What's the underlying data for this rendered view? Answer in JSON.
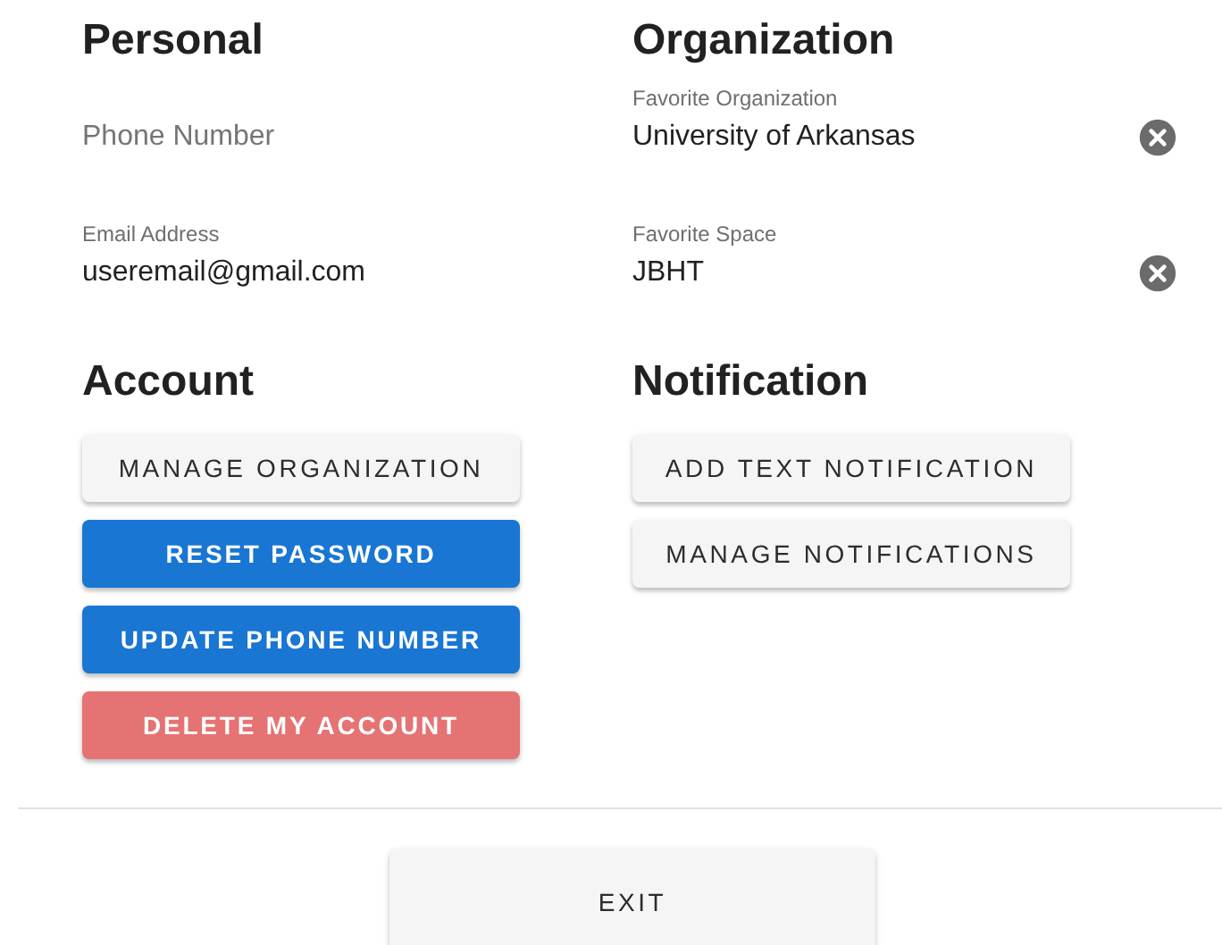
{
  "info_sections": [
    {
      "title": "Personal",
      "fields": [
        {
          "placeholder": "Phone Number",
          "clearable": false
        },
        {
          "label": "Email Address",
          "value": "useremail@gmail.com",
          "clearable": false
        }
      ]
    },
    {
      "title": "Organization",
      "fields": [
        {
          "label": "Favorite Organization",
          "value": "University of Arkansas",
          "clearable": true
        },
        {
          "label": "Favorite Space",
          "value": "JBHT",
          "clearable": true
        }
      ]
    }
  ],
  "action_sections": [
    {
      "title": "Account",
      "buttons": [
        {
          "label": "MANAGE ORGANIZATION",
          "kind": "default"
        },
        {
          "label": "RESET PASSWORD",
          "kind": "primary"
        },
        {
          "label": "UPDATE PHONE NUMBER",
          "kind": "primary"
        },
        {
          "label": "DELETE MY ACCOUNT",
          "kind": "danger"
        }
      ]
    },
    {
      "title": "Notification",
      "buttons": [
        {
          "label": "ADD TEXT NOTIFICATION",
          "kind": "default"
        },
        {
          "label": "MANAGE NOTIFICATIONS",
          "kind": "default"
        }
      ]
    }
  ],
  "exit_button": "EXIT"
}
